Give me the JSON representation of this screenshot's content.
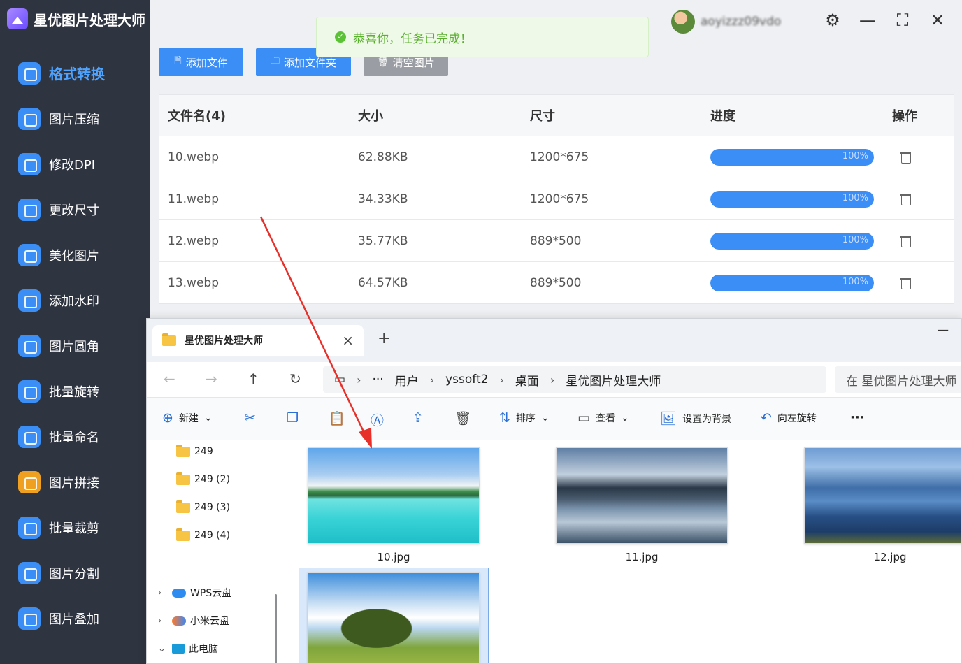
{
  "app": {
    "title": "星优图片处理大师",
    "toast": "恭喜你，任务已完成！"
  },
  "sidebar": {
    "items": [
      {
        "label": "格式转换",
        "icon": "format-convert-icon",
        "color": "#3a8ef6",
        "active": true
      },
      {
        "label": "图片压缩",
        "icon": "compress-icon",
        "color": "#3a8ef6"
      },
      {
        "label": "修改DPI",
        "icon": "dpi-icon",
        "color": "#3a8ef6"
      },
      {
        "label": "更改尺寸",
        "icon": "resize-icon",
        "color": "#3a8ef6"
      },
      {
        "label": "美化图片",
        "icon": "beautify-icon",
        "color": "#3a8ef6"
      },
      {
        "label": "添加水印",
        "icon": "watermark-icon",
        "color": "#3a8ef6"
      },
      {
        "label": "图片圆角",
        "icon": "round-corner-icon",
        "color": "#3a8ef6"
      },
      {
        "label": "批量旋转",
        "icon": "rotate-icon",
        "color": "#3a8ef6"
      },
      {
        "label": "批量命名",
        "icon": "rename-icon",
        "color": "#3a8ef6"
      },
      {
        "label": "图片拼接",
        "icon": "stitch-icon",
        "color": "#f0a020"
      },
      {
        "label": "批量裁剪",
        "icon": "crop-icon",
        "color": "#3a8ef6"
      },
      {
        "label": "图片分割",
        "icon": "split-icon",
        "color": "#3a8ef6"
      },
      {
        "label": "图片叠加",
        "icon": "overlay-icon",
        "color": "#3a8ef6"
      }
    ]
  },
  "toolbar": {
    "add_file": "添加文件",
    "add_folder": "添加文件夹",
    "clear": "清空图片"
  },
  "user": {
    "name": "aoyizzz09vdo"
  },
  "table": {
    "headers": [
      "文件名(4)",
      "大小",
      "尺寸",
      "进度",
      "操作"
    ],
    "rows": [
      {
        "name": "10.webp",
        "size": "62.88KB",
        "dims": "1200*675",
        "progress": 100,
        "progress_label": "100%"
      },
      {
        "name": "11.webp",
        "size": "34.33KB",
        "dims": "1200*675",
        "progress": 100,
        "progress_label": "100%"
      },
      {
        "name": "12.webp",
        "size": "35.77KB",
        "dims": "889*500",
        "progress": 100,
        "progress_label": "100%"
      },
      {
        "name": "13.webp",
        "size": "64.57KB",
        "dims": "889*500",
        "progress": 100,
        "progress_label": "100%"
      }
    ]
  },
  "explorer": {
    "tab_title": "星优图片处理大师",
    "breadcrumb": [
      "用户",
      "yssoft2",
      "桌面",
      "星优图片处理大师"
    ],
    "ellipsis": "···",
    "search_placeholder": "在 星优图片处理大师",
    "commands": {
      "new": "新建",
      "sort": "排序",
      "view": "查看",
      "set_bg": "设置为背景",
      "rotate_left": "向左旋转",
      "more": "···"
    },
    "tree": {
      "folders": [
        "249",
        "249 (2)",
        "249 (3)",
        "249 (4)"
      ],
      "roots": [
        "WPS云盘",
        "小米云盘",
        "此电脑"
      ]
    },
    "files": [
      "10.jpg",
      "11.jpg",
      "12.jpg",
      ""
    ]
  }
}
